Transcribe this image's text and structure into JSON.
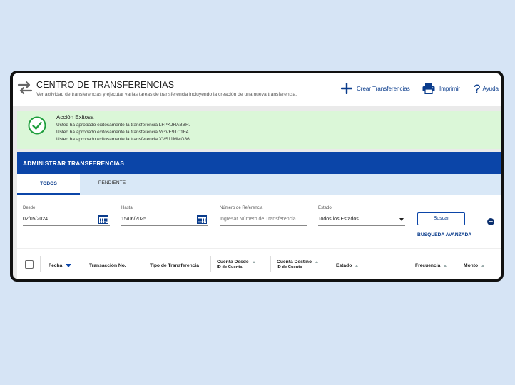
{
  "header": {
    "title": "CENTRO DE TRANSFERENCIAS",
    "subtitle": "Ver actividad de transferencias y ejecutar varias tareas de transferencia incluyendo la creación de una nueva transferencia.",
    "actions": {
      "create": "Crear Transferencias",
      "print": "Imprimir",
      "help": "Ayuda"
    }
  },
  "alert": {
    "title": "Acción Exitosa",
    "lines": [
      "Usted ha aprobado exitosamente la transferencia LFPKJHABBR.",
      "Usted ha aprobado exitosamente la transferencia VGVE9TC1F4.",
      "Usted ha aprobado exitosamente la transferencia XVS11MMG86."
    ]
  },
  "panel": {
    "title": "ADMINISTRAR TRANSFERENCIAS",
    "tabs": [
      "TODOS",
      "PENDIENTE"
    ]
  },
  "filters": {
    "from_label": "Desde",
    "from_value": "02/05/2024",
    "to_label": "Hasta",
    "to_value": "15/06/2025",
    "ref_label": "Número de Referencia",
    "ref_placeholder": "Ingresar Número de Transferencia",
    "status_label": "Estado",
    "status_value": "Todos los Estados",
    "search_button": "Buscar",
    "advanced_link": "BÚSQUEDA AVANZADA"
  },
  "table": {
    "columns": {
      "date": "Fecha",
      "txn": "Transacción No.",
      "type": "Tipo de Transferencia",
      "from_account": "Cuenta Desde",
      "from_account_sub": "ID de Cuenta",
      "to_account": "Cuenta Destino",
      "to_account_sub": "ID de Cuenta",
      "status": "Estado",
      "frequency": "Frecuencia",
      "amount": "Monto"
    }
  },
  "colors": {
    "brand_blue": "#0b45a8",
    "success_bg": "#dbf7d8",
    "success_icon": "#1e9e3c",
    "background": "#d6e4f5"
  }
}
